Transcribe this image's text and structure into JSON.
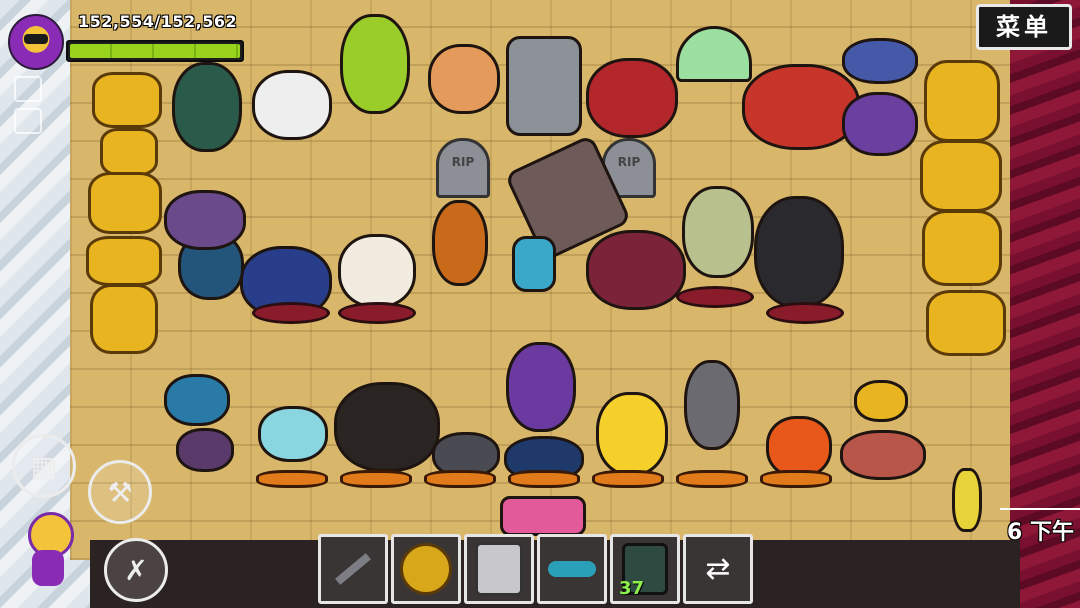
{
  "hud": {
    "health_text": "152,554/152,562",
    "health_fraction": 0.99995,
    "menu_label": "菜单",
    "time_label": "6 下午"
  },
  "hotbar": {
    "slots": [
      {
        "name": "spear-icon"
      },
      {
        "name": "golden-shield-icon"
      },
      {
        "name": "silver-shield-icon"
      },
      {
        "name": "boomerang-icon"
      },
      {
        "name": "health-potion-icon",
        "count": "37"
      },
      {
        "name": "swap-icon"
      }
    ]
  },
  "gravestones": [
    "RIP",
    "RIP"
  ],
  "colors": {
    "floor": "#d9b76a",
    "health": "#9ad31e",
    "crimson": "#7a1030"
  }
}
